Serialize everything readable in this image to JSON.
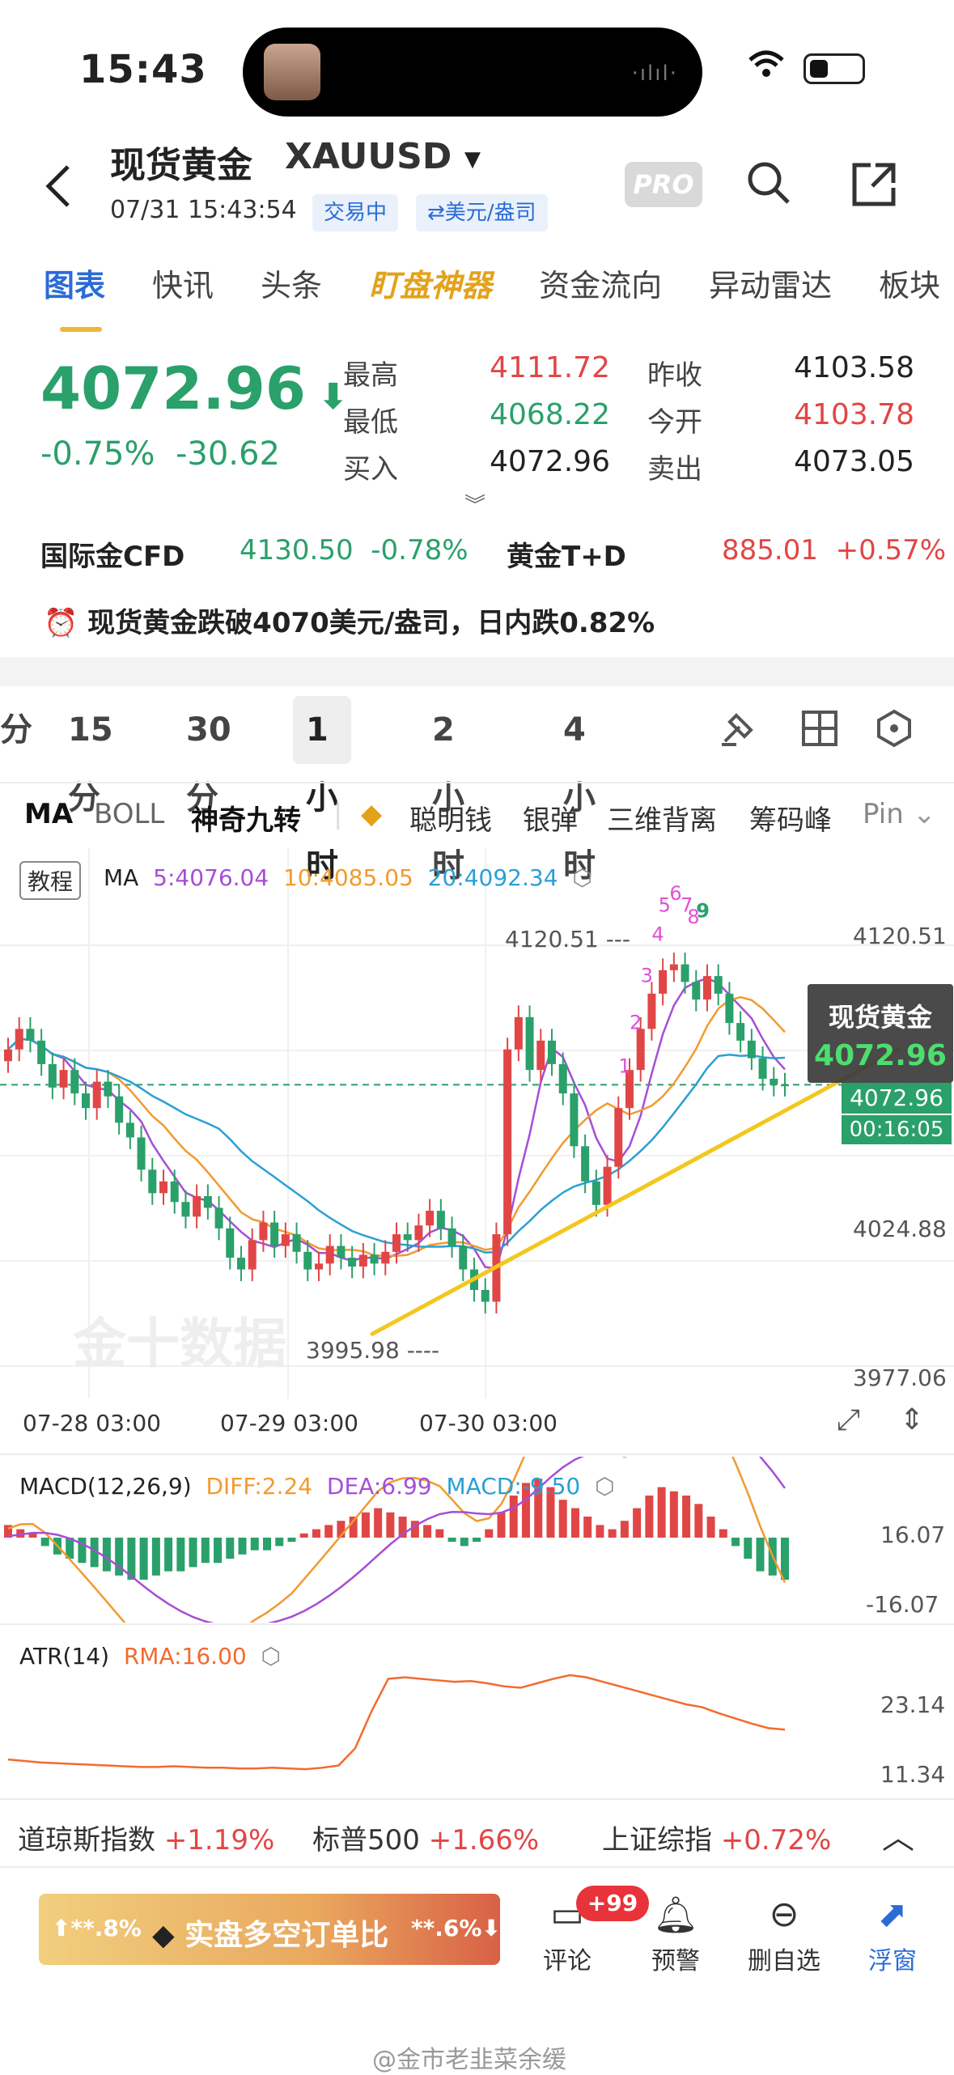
{
  "status_bar": {
    "time": "15:43"
  },
  "header": {
    "title": "现货黄金",
    "symbol": "XAUUSD",
    "datetime": "07/31 15:43:54",
    "trading_status": "交易中",
    "unit": "⇄美元/盎司",
    "pro_label": "PRO"
  },
  "tabs": [
    "图表",
    "快讯",
    "头条",
    "盯盘神器",
    "资金流向",
    "异动雷达",
    "板块"
  ],
  "quote": {
    "price": "4072.96",
    "change_pct": "-0.75%",
    "change_abs": "-30.62",
    "high_label": "最高",
    "high": "4111.72",
    "low_label": "最低",
    "low": "4068.22",
    "bid_label": "买入",
    "bid": "4072.96",
    "prev_close_label": "昨收",
    "prev_close": "4103.58",
    "open_label": "今开",
    "open": "4103.78",
    "ask_label": "卖出",
    "ask": "4073.05"
  },
  "related": {
    "cfd_label": "国际金CFD",
    "cfd_value": "4130.50",
    "cfd_change": "-0.78%",
    "td_label": "黄金T+D",
    "td_value": "885.01",
    "td_change": "+0.57%"
  },
  "alert": "现货黄金跌破4070美元/盎司，日内跌0.82%",
  "periods": [
    "分",
    "15分",
    "30分",
    "1小时",
    "2小时",
    "4小时"
  ],
  "selected_period": "1小时",
  "indicators": [
    "MA",
    "BOLL",
    "神奇九转",
    "聪明钱",
    "银弹",
    "三维背离",
    "筹码峰",
    "Pin"
  ],
  "main_chart": {
    "tutorial_label": "教程",
    "ma_label": "MA",
    "ma5": "5:4076.04",
    "ma10": "10:4085.05",
    "ma20": "20:4092.34",
    "high_marker": "4120.51",
    "low_marker": "3995.98",
    "y_ticks": [
      "4120.51",
      "4024.88",
      "3977.06"
    ],
    "current_price_tag": "4072.96",
    "countdown": "00:16:05",
    "overlay_name": "现货黄金",
    "overlay_price": "4072.96",
    "x_ticks": [
      "07-28 03:00",
      "07-29 03:00",
      "07-30 03:00"
    ],
    "watermark": "金十数据",
    "td9_labels": [
      "1",
      "2",
      "3",
      "4",
      "5",
      "6",
      "7",
      "8",
      "9"
    ]
  },
  "chart_data": [
    {
      "type": "candlestick",
      "title": "现货黄金 XAUUSD 1小时",
      "ylim": [
        3977.06,
        4120.51
      ],
      "x_ticks": [
        "07-28 03:00",
        "07-29 03:00",
        "07-30 03:00"
      ],
      "close": [
        4085,
        4092,
        4088,
        4080,
        4072,
        4078,
        4070,
        4065,
        4074,
        4069,
        4060,
        4055,
        4044,
        4036,
        4040,
        4033,
        4028,
        4035,
        4031,
        4024,
        4014,
        4010,
        4020,
        4026,
        4018,
        4022,
        4016,
        4010,
        4012,
        4018,
        4014,
        4011,
        4015,
        4012,
        4016,
        4022,
        4020,
        4025,
        4030,
        4024,
        4018,
        4010,
        4003,
        3999,
        4022,
        4085,
        4096,
        4078,
        4088,
        4080,
        4070,
        4052,
        4040,
        4032,
        4045,
        4065,
        4078,
        4092,
        4104,
        4112,
        4114,
        4108,
        4102,
        4110,
        4104,
        4094,
        4088,
        4082,
        4075,
        4073,
        4072.96
      ],
      "ma5_last": 4076.04,
      "ma10_last": 4085.05,
      "ma20_last": 4092.34,
      "high": 4120.51,
      "low": 3995.98,
      "current": 4072.96
    },
    {
      "type": "bar",
      "title": "MACD(12,26,9)",
      "diff": 2.24,
      "dea": 6.99,
      "macd": -9.5,
      "ylim": [
        -16.07,
        16.07
      ],
      "histogram": [
        3,
        2,
        1,
        -2,
        -4,
        -5,
        -6,
        -7,
        -8,
        -9,
        -10,
        -10,
        -9,
        -8,
        -8,
        -7,
        -6,
        -6,
        -5,
        -4,
        -3,
        -3,
        -2,
        -1,
        1,
        2,
        3,
        4,
        5,
        6,
        7,
        6,
        5,
        4,
        3,
        2,
        -1,
        -2,
        -1,
        2,
        6,
        10,
        13,
        14,
        12,
        9,
        7,
        5,
        3,
        2,
        4,
        7,
        10,
        12,
        11,
        10,
        8,
        5,
        2,
        -2,
        -5,
        -8,
        -9,
        -10
      ]
    },
    {
      "type": "line",
      "title": "ATR(14)",
      "rma": 16.0,
      "ylim": [
        11.34,
        23.14
      ],
      "values": [
        12,
        11.8,
        11.6,
        11.5,
        11.4,
        11.3,
        11.2,
        11.1,
        11.0,
        11.0,
        11.1,
        11.0,
        10.9,
        10.9,
        10.8,
        10.8,
        10.9,
        10.8,
        10.7,
        10.9,
        11.2,
        13.5,
        18.5,
        22.8,
        23.0,
        22.8,
        22.6,
        22.4,
        22.5,
        22.2,
        21.8,
        21.6,
        22.2,
        22.8,
        23.3,
        23.0,
        22.4,
        21.8,
        21.2,
        20.6,
        20.0,
        19.4,
        19.0,
        18.2,
        17.5,
        16.8,
        16.2,
        16.0
      ]
    }
  ],
  "macd_chart": {
    "label": "MACD(12,26,9)",
    "diff": "DIFF:2.24",
    "dea": "DEA:6.99",
    "macd": "MACD:-9.50",
    "y_top": "16.07",
    "y_bottom": "-16.07"
  },
  "atr_chart": {
    "label": "ATR(14)",
    "rma": "RMA:16.00",
    "y_top": "23.14",
    "y_bottom": "11.34"
  },
  "index_bar": [
    {
      "name": "道琼斯指数",
      "change": "+1.19%"
    },
    {
      "name": "标普500",
      "change": "+1.66%"
    },
    {
      "name": "上证综指",
      "change": "+0.72%"
    }
  ],
  "bottom_bar": {
    "pk_left": "⬆**.8%",
    "pk_label": "实盘多空订单比",
    "pk_right": "**.6%⬇",
    "comment": "评论",
    "badge": "+99",
    "alarm": "预警",
    "remove_watch": "删自选",
    "float_window": "浮窗"
  },
  "footer_watermark": "@金市老韭菜余缓",
  "colors": {
    "up": "#e14646",
    "down": "#2aa06a",
    "accent": "#2a6bd6",
    "trend": "#f3c71e"
  }
}
